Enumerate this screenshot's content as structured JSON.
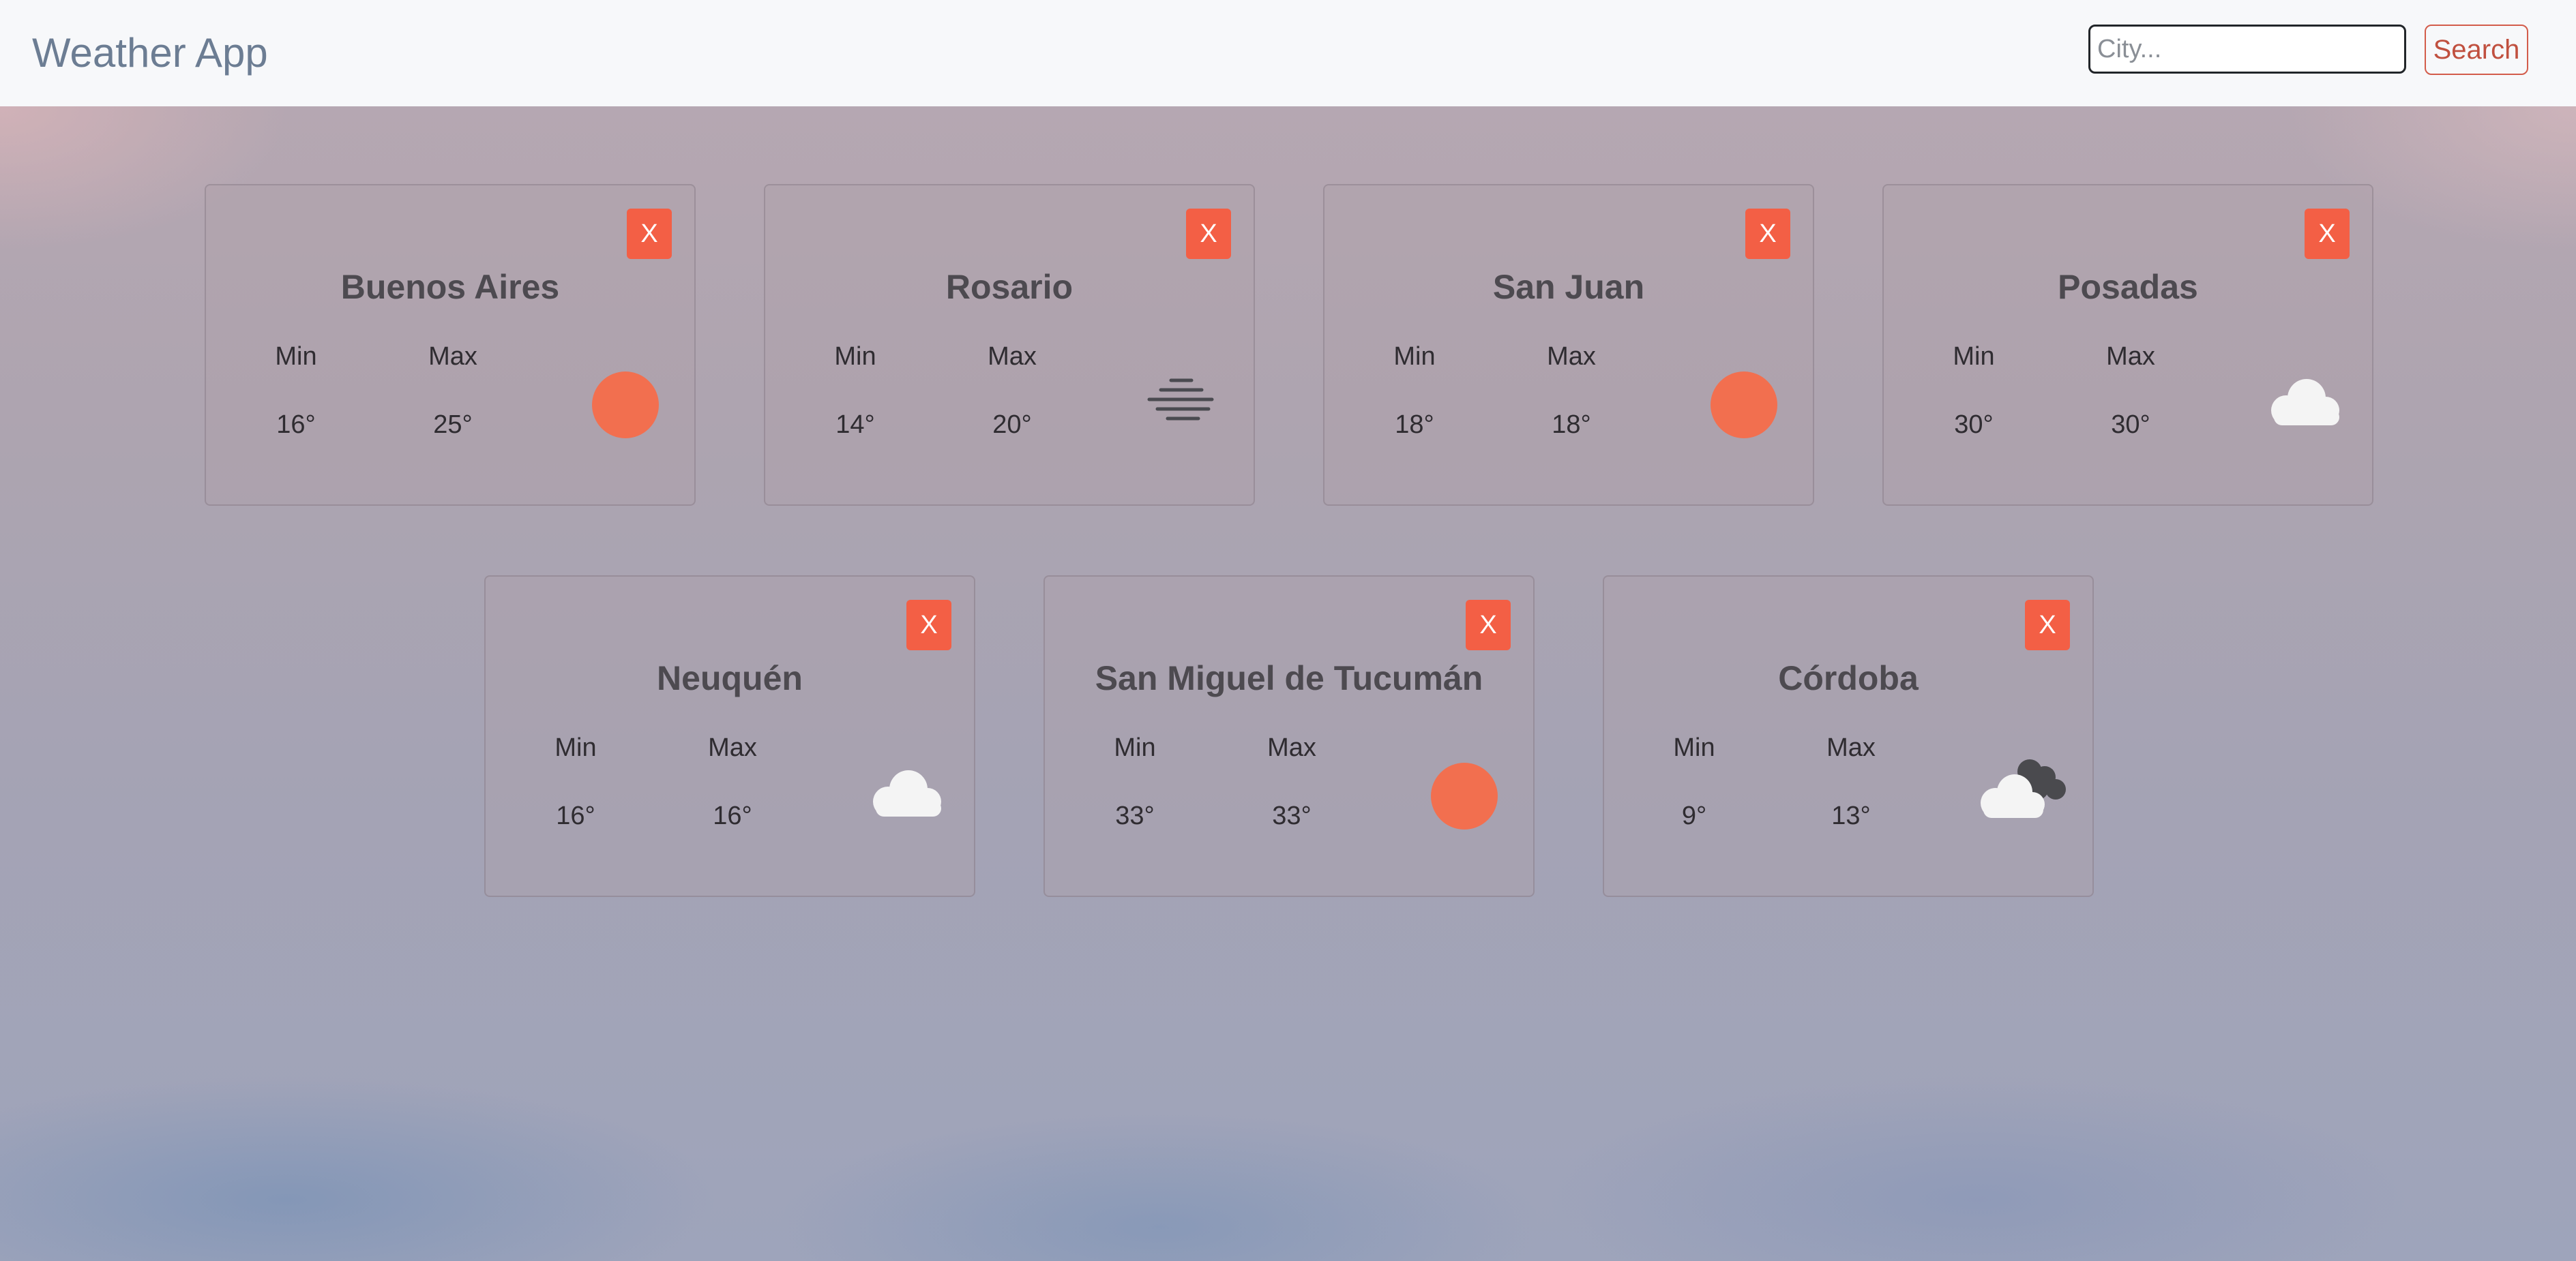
{
  "app": {
    "title": "Weather App"
  },
  "search": {
    "placeholder": "City...",
    "value": "",
    "button_label": "Search"
  },
  "labels": {
    "min": "Min",
    "max": "Max",
    "close": "X"
  },
  "colors": {
    "accent": "#f35f45",
    "sun": "#f26f4f",
    "navbar": "#f7f8fa"
  },
  "cards": [
    {
      "city": "Buenos Aires",
      "min": "16°",
      "max": "25°",
      "icon": "sun-icon"
    },
    {
      "city": "Rosario",
      "min": "14°",
      "max": "20°",
      "icon": "fog-icon"
    },
    {
      "city": "San Juan",
      "min": "18°",
      "max": "18°",
      "icon": "sun-icon"
    },
    {
      "city": "Posadas",
      "min": "30°",
      "max": "30°",
      "icon": "cloud-icon"
    },
    {
      "city": "Neuquén",
      "min": "16°",
      "max": "16°",
      "icon": "cloud-icon"
    },
    {
      "city": "San Miguel de Tucumán",
      "min": "33°",
      "max": "33°",
      "icon": "sun-icon"
    },
    {
      "city": "Córdoba",
      "min": "9°",
      "max": "13°",
      "icon": "dark-cloud-icon"
    }
  ]
}
